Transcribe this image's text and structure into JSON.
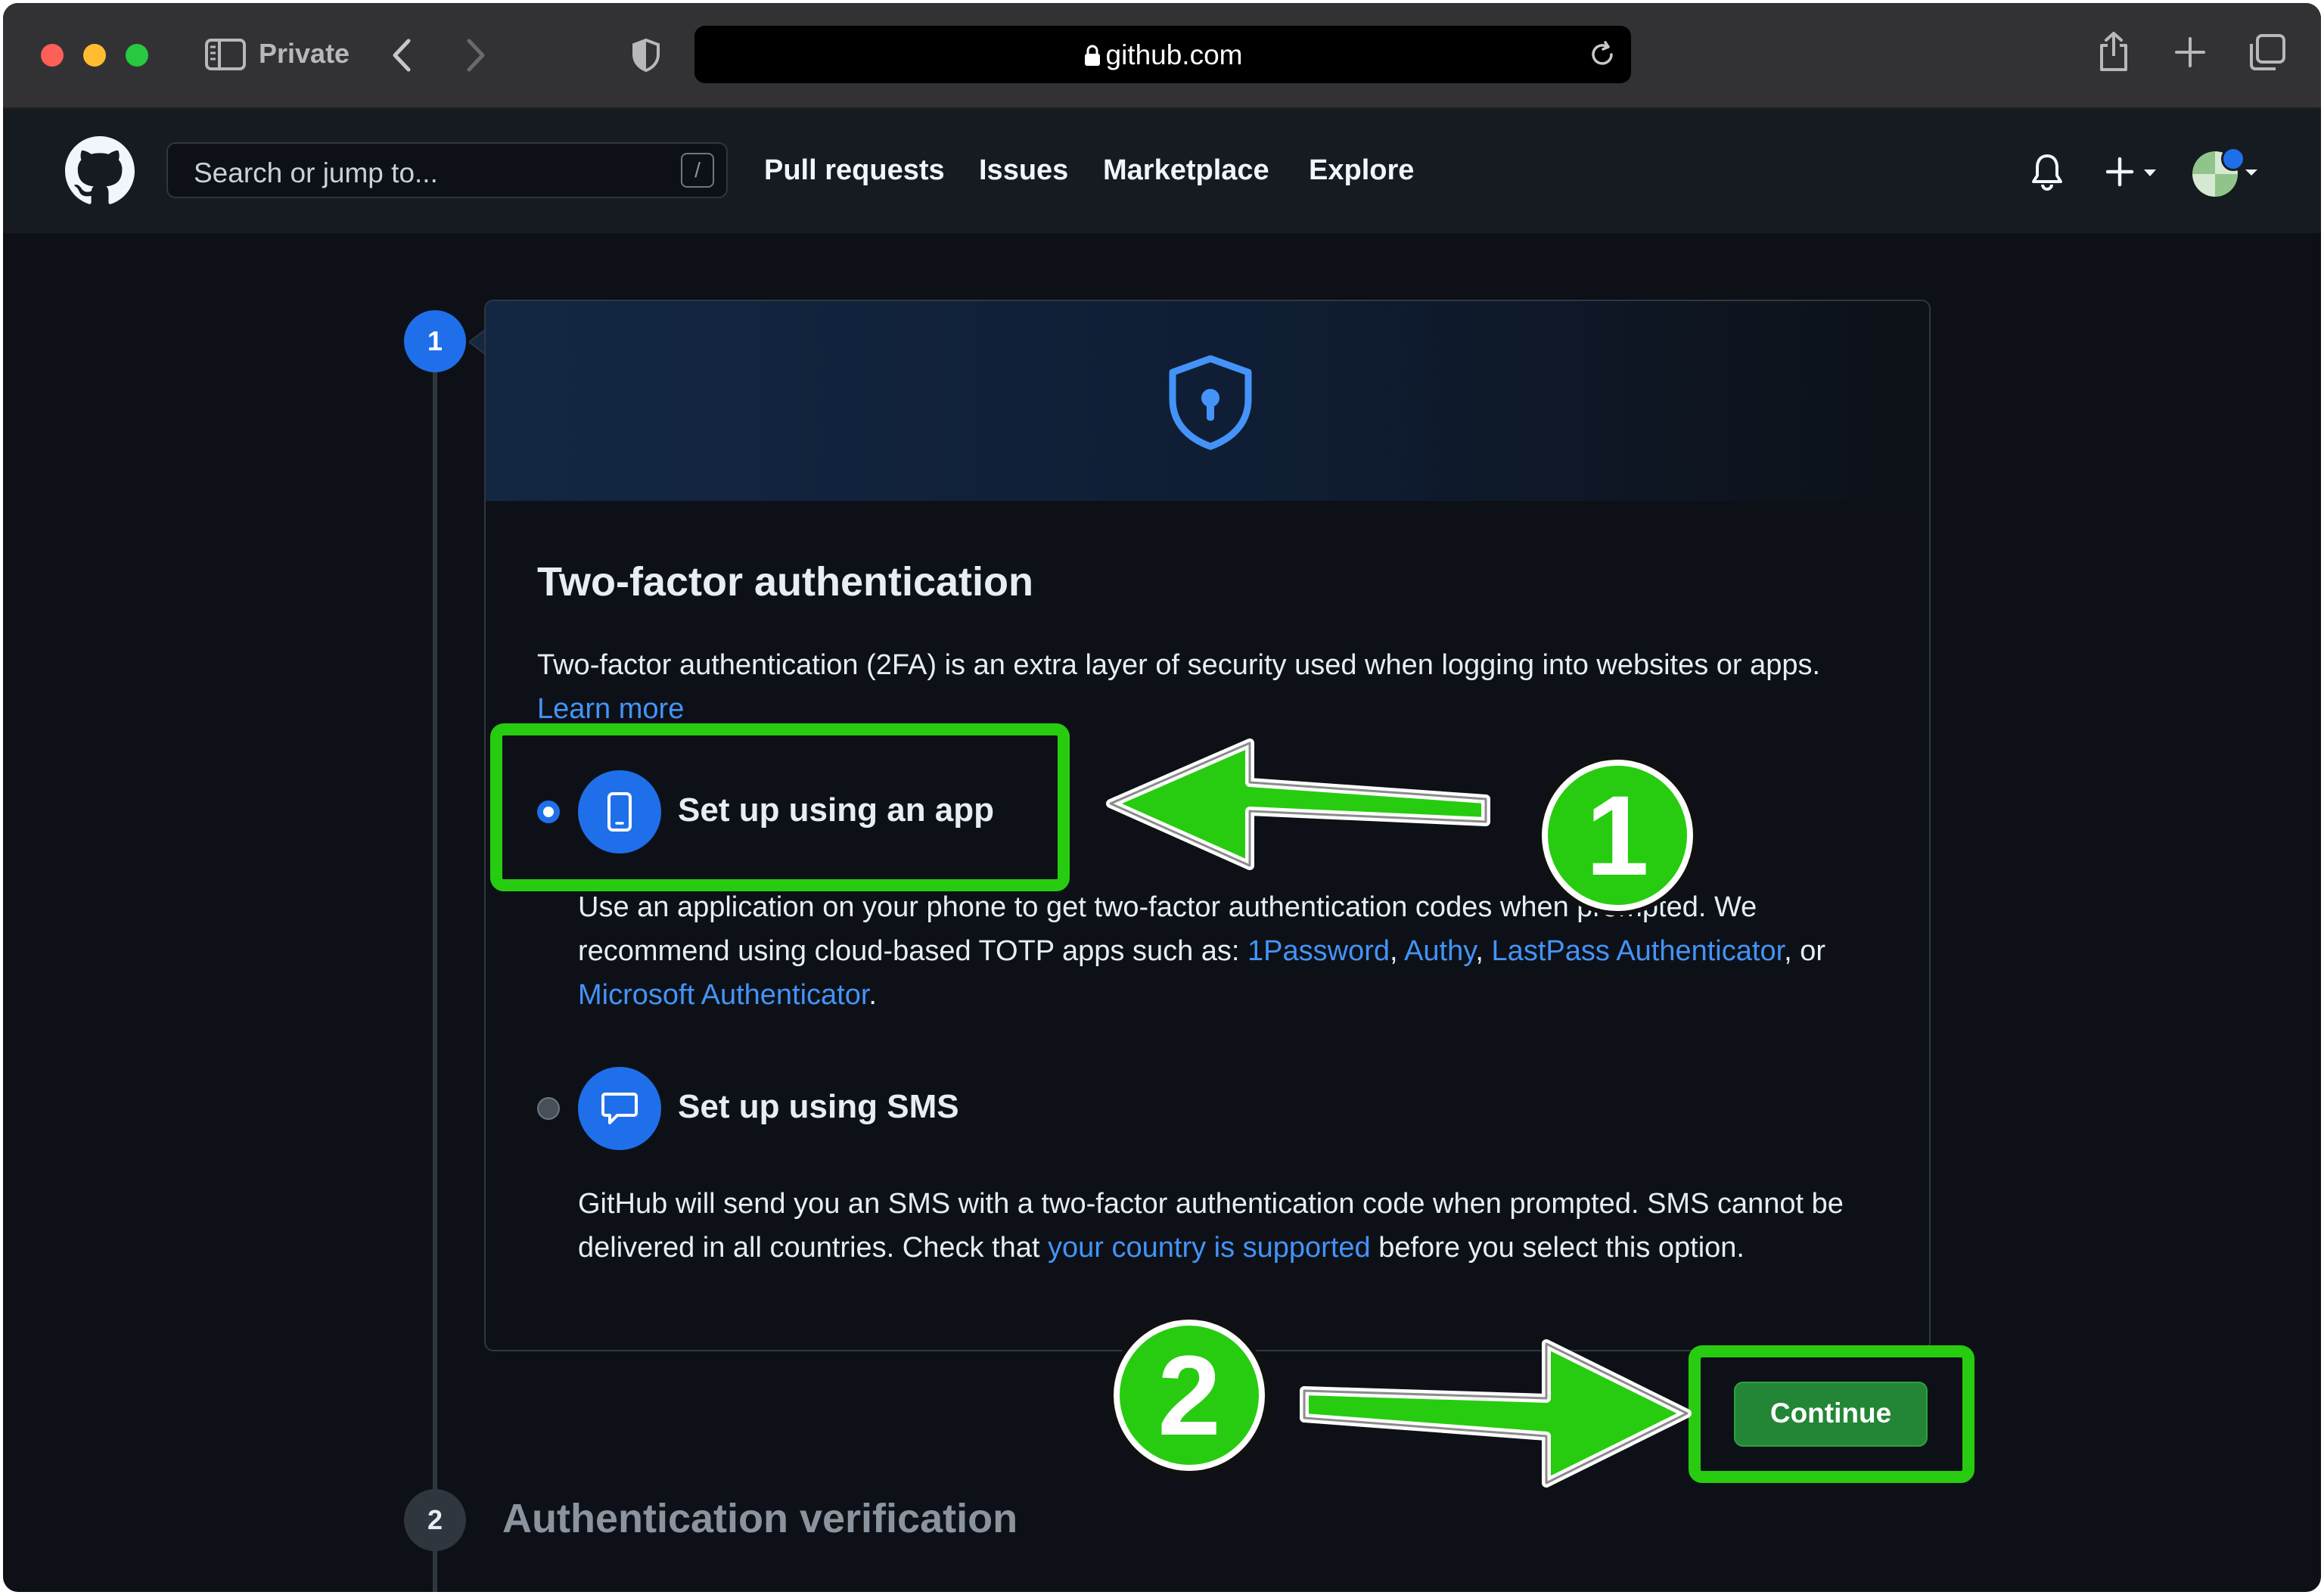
{
  "browser": {
    "private_label": "Private",
    "url": "github.com"
  },
  "header": {
    "search_placeholder": "Search or jump to...",
    "search_shortcut": "/",
    "nav": [
      "Pull requests",
      "Issues",
      "Marketplace",
      "Explore"
    ]
  },
  "steps": {
    "step1_number": "1",
    "step2_number": "2",
    "step2_label": "Authentication verification"
  },
  "card": {
    "title": "Two-factor authentication",
    "intro": "Two-factor authentication (2FA) is an extra layer of security used when logging into websites or apps.",
    "learn_more": "Learn more",
    "options": [
      {
        "label": "Set up using an app",
        "selected": true,
        "desc_prefix": "Use an application on your phone to get two-factor authentication codes when prompted. We recommend using cloud-based TOTP apps such as:",
        "apps": [
          "1Password",
          "Authy",
          "LastPass Authenticator",
          "Microsoft Authenticator"
        ]
      },
      {
        "label": "Set up using SMS",
        "selected": false,
        "desc_prefix": "GitHub will send you an SMS with a two-factor authentication code when prompted. SMS cannot be delivered in all countries. Check that",
        "desc_link": "your country is supported",
        "desc_suffix": "before you select this option."
      }
    ],
    "continue_label": "Continue"
  },
  "annotations": {
    "marker1": "1",
    "marker2": "2",
    "color": "#27cc10"
  },
  "colors": {
    "page_bg": "#0d1117",
    "header_bg": "#161b22",
    "accent_blue": "#1f6feb",
    "link_blue": "#4493f8",
    "button_green": "#238636"
  }
}
